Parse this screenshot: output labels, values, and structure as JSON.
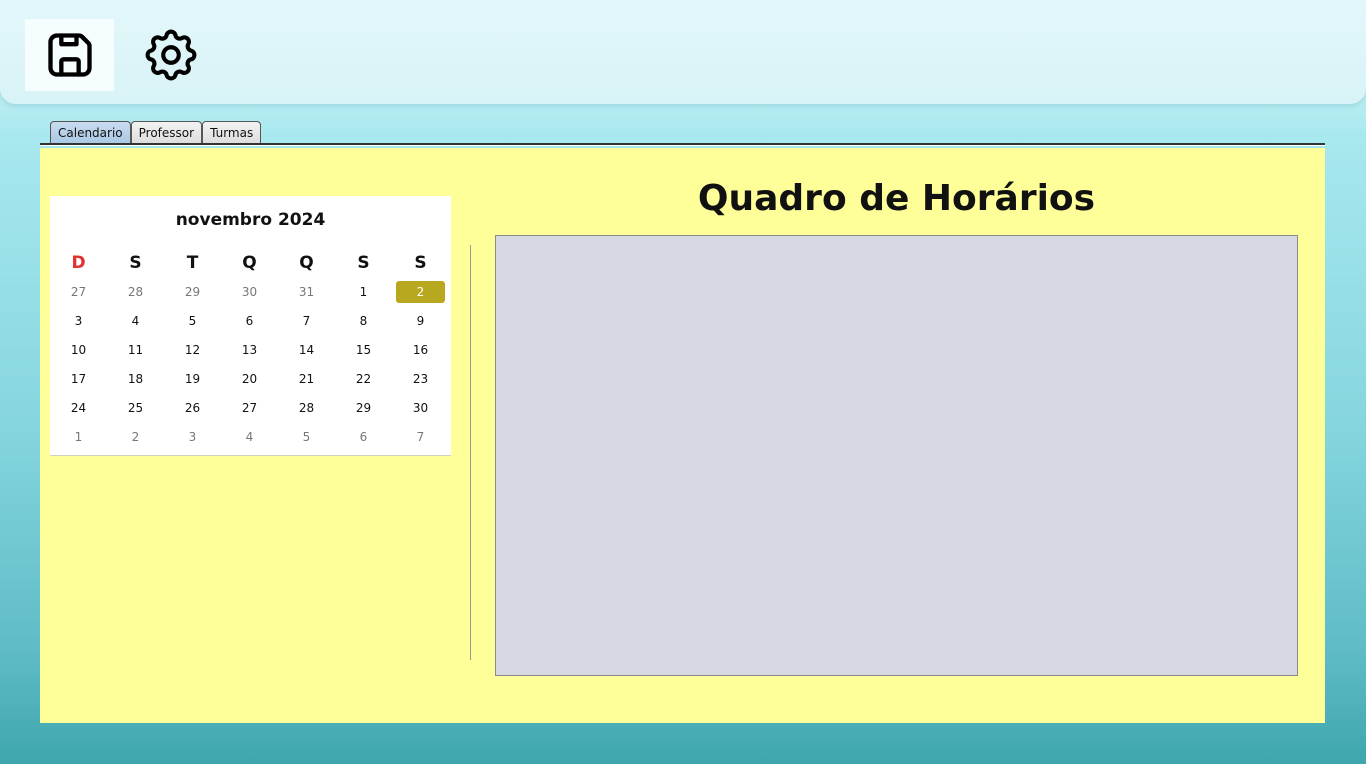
{
  "toolbar": {
    "save_icon": "save-floppy-icon",
    "settings_icon": "gear-icon"
  },
  "tabs": [
    {
      "label": "Calendario",
      "active": true
    },
    {
      "label": "Professor",
      "active": false
    },
    {
      "label": "Turmas",
      "active": false
    }
  ],
  "calendar": {
    "month_label": "novembro 2024",
    "weekday_headers": [
      "D",
      "S",
      "T",
      "Q",
      "Q",
      "S",
      "S"
    ],
    "sunday_color": "#e23030",
    "selected_color": "#b8a81f",
    "weeks": [
      [
        {
          "d": "27",
          "muted": true
        },
        {
          "d": "28",
          "muted": true
        },
        {
          "d": "29",
          "muted": true
        },
        {
          "d": "30",
          "muted": true
        },
        {
          "d": "31",
          "muted": true
        },
        {
          "d": "1"
        },
        {
          "d": "2",
          "selected": true
        }
      ],
      [
        {
          "d": "3"
        },
        {
          "d": "4"
        },
        {
          "d": "5"
        },
        {
          "d": "6"
        },
        {
          "d": "7"
        },
        {
          "d": "8"
        },
        {
          "d": "9"
        }
      ],
      [
        {
          "d": "10"
        },
        {
          "d": "11"
        },
        {
          "d": "12"
        },
        {
          "d": "13"
        },
        {
          "d": "14"
        },
        {
          "d": "15"
        },
        {
          "d": "16"
        }
      ],
      [
        {
          "d": "17"
        },
        {
          "d": "18"
        },
        {
          "d": "19"
        },
        {
          "d": "20"
        },
        {
          "d": "21"
        },
        {
          "d": "22"
        },
        {
          "d": "23"
        }
      ],
      [
        {
          "d": "24"
        },
        {
          "d": "25"
        },
        {
          "d": "26"
        },
        {
          "d": "27"
        },
        {
          "d": "28"
        },
        {
          "d": "29"
        },
        {
          "d": "30"
        }
      ],
      [
        {
          "d": "1",
          "muted": true
        },
        {
          "d": "2",
          "muted": true
        },
        {
          "d": "3",
          "muted": true
        },
        {
          "d": "4",
          "muted": true
        },
        {
          "d": "5",
          "muted": true
        },
        {
          "d": "6",
          "muted": true
        },
        {
          "d": "7",
          "muted": true
        }
      ]
    ]
  },
  "main": {
    "title": "Quadro de Horários"
  },
  "colors": {
    "panel_background": "#ffff99",
    "schedule_background": "#d6d9e1"
  }
}
